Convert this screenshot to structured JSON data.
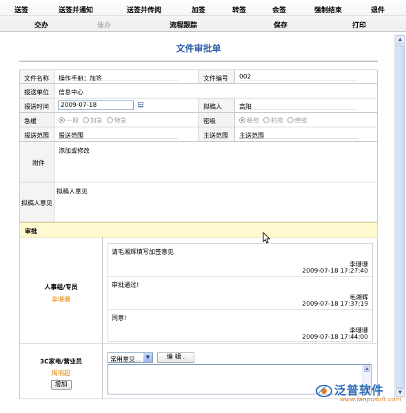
{
  "toolbar": {
    "row1": [
      "送签",
      "送签并通知",
      "送签并传阅",
      "加签",
      "转签",
      "会签",
      "强制结束",
      "退件"
    ],
    "row2": {
      "delegate": "交办",
      "urge": "催办",
      "track": "流程跟踪",
      "save": "保存",
      "print": "打印"
    }
  },
  "form": {
    "title": "文件审批单",
    "file_name_label": "文件名称",
    "file_name_value": "操作手册：加签",
    "file_no_label": "文件编号",
    "file_no_value": "002",
    "unit_label": "报送单位",
    "unit_value": "信息中心",
    "date_label": "报送时间",
    "date_value": "2009-07-18",
    "drafter_label": "拟稿人",
    "drafter_value": "高阳",
    "urgency_label": "急缓",
    "urgency_options": [
      "一般",
      "加急",
      "特急"
    ],
    "urgency_selected": "一般",
    "secrecy_label": "密级",
    "secrecy_options": [
      "秘密",
      "机密",
      "绝密"
    ],
    "secrecy_selected": "秘密",
    "scope_label": "报送范围",
    "scope_value": "报送范围",
    "main_scope_label": "主送范围",
    "main_scope_value": "主送范围",
    "attachment_label": "附件",
    "attachment_link": "添加或修改",
    "opinion_label": "拟稿人意见",
    "opinion_value": "拟稿人意见"
  },
  "approval": {
    "heading": "审批",
    "group1": {
      "role": "人事组/专员",
      "person": "李珊珊",
      "comments": [
        {
          "text": "请毛湘辉填写加签意见",
          "name": "李珊珊",
          "time": "2009-07-18 17:27:40"
        },
        {
          "text": "审批通过!",
          "name": "毛湘辉",
          "time": "2009-07-18 17:37:19"
        },
        {
          "text": "同意!",
          "name": "李珊珊",
          "time": "2009-07-18 17:44:00"
        }
      ]
    },
    "group2": {
      "role": "3C家电/营业员",
      "person": "周明超",
      "add_button": "增加",
      "select_value": "常用意见...",
      "edit_button": "编 辑 ."
    }
  },
  "brand": {
    "name": "泛普软件",
    "url": "www.fanpusoft.com"
  },
  "colors": {
    "title_blue": "#2a5ea8",
    "person_orange": "#e08000",
    "approval_bg": "#fff9d0"
  }
}
